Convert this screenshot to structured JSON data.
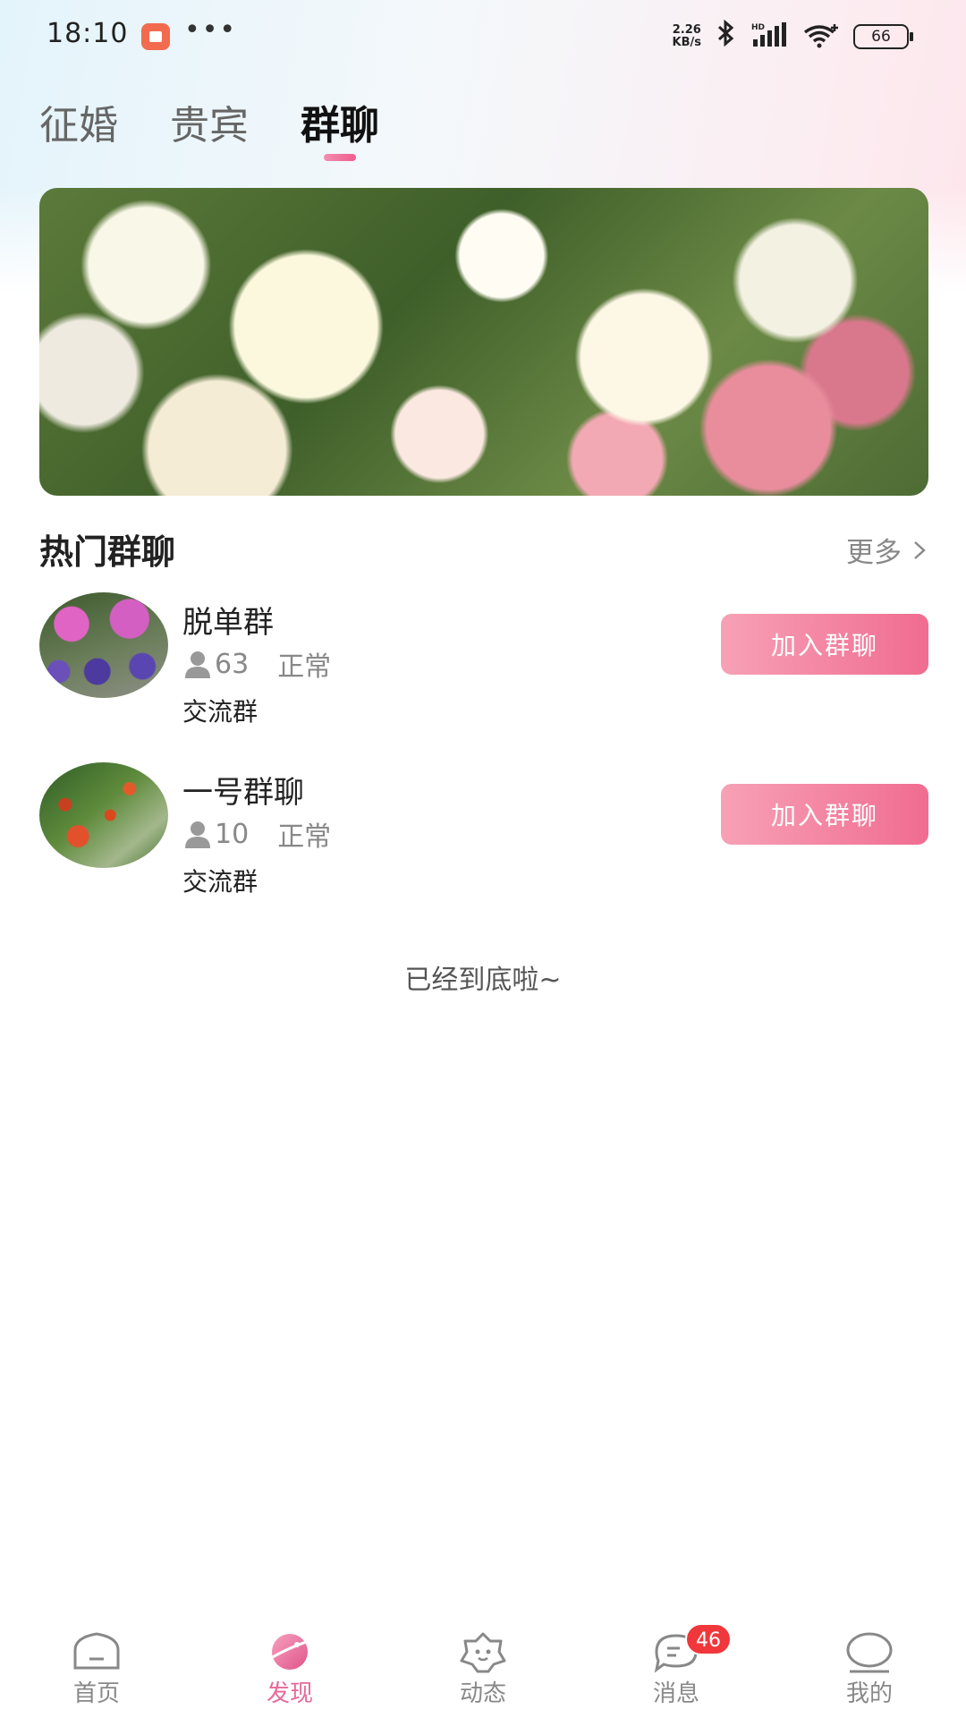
{
  "status_bar": {
    "time": "18:10",
    "dots": "•••",
    "net_speed_value": "2.26",
    "net_speed_unit": "KB/s",
    "battery": "66"
  },
  "tabs": [
    {
      "label": "征婚",
      "active": false
    },
    {
      "label": "贵宾",
      "active": false
    },
    {
      "label": "群聊",
      "active": true
    }
  ],
  "section": {
    "title": "热门群聊",
    "more_label": "更多"
  },
  "groups": [
    {
      "name": "脱单群",
      "members": "63",
      "status": "正常",
      "type": "交流群",
      "button": "加入群聊"
    },
    {
      "name": "一号群聊",
      "members": "10",
      "status": "正常",
      "type": "交流群",
      "button": "加入群聊"
    }
  ],
  "end_text": "已经到底啦~",
  "bottom_nav": [
    {
      "label": "首页",
      "icon": "home-icon"
    },
    {
      "label": "发现",
      "icon": "discover-icon",
      "active": true
    },
    {
      "label": "动态",
      "icon": "moments-icon"
    },
    {
      "label": "消息",
      "icon": "message-icon",
      "badge": "46"
    },
    {
      "label": "我的",
      "icon": "profile-icon"
    }
  ],
  "colors": {
    "accent": "#f06c90",
    "active_nav": "#e6699a",
    "badge": "#f0373b"
  }
}
